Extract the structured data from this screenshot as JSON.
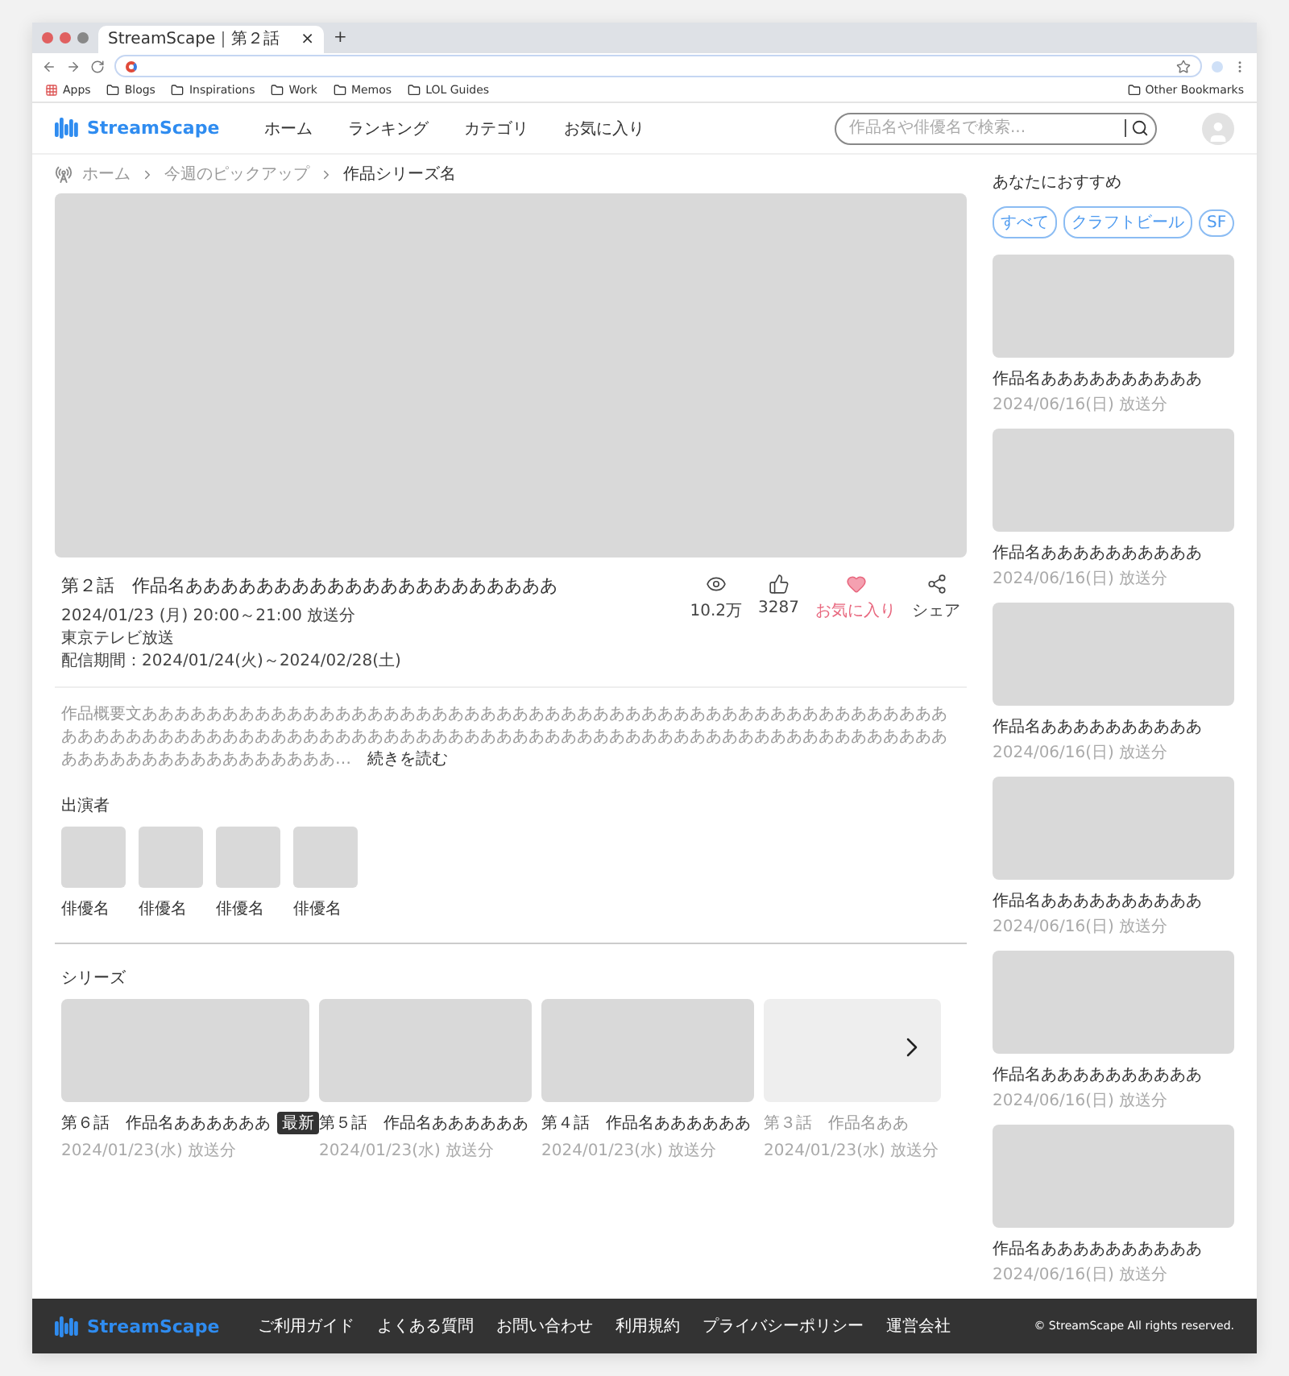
{
  "browser": {
    "tab_title": "StreamScape｜第２話",
    "tab_close": "×",
    "new_tab": "+",
    "bookmarks": [
      "Apps",
      "Blogs",
      "Inspirations",
      "Work",
      "Memos",
      "LOL Guides"
    ],
    "other_bookmarks": "Other Bookmarks"
  },
  "header": {
    "logo": "StreamScape",
    "nav": [
      "ホーム",
      "ランキング",
      "カテゴリ",
      "お気に入り"
    ],
    "search": {
      "placeholder": "作品名や俳優名で検索..."
    }
  },
  "breadcrumb": [
    "ホーム",
    "今週のピックアップ",
    "作品シリーズ名"
  ],
  "episode": {
    "title": "第２話　作品名あああああああああああああああああああああ",
    "meta": [
      "2024/01/23 (月) 20:00～21:00  放送分",
      "東京テレビ放送",
      "配信期間：2024/01/24(火)～2024/02/28(土)"
    ],
    "actions": [
      {
        "kind": "views",
        "label": "10.2万",
        "on": false
      },
      {
        "kind": "likes",
        "label": "3287",
        "on": false
      },
      {
        "kind": "favorite",
        "label": "お気に入り",
        "on": true
      },
      {
        "kind": "share",
        "label": "シェア",
        "on": false
      }
    ],
    "summary": "作品概要文ああああああああああああああああああああああああああああああああああああああああああああああああああああああああああああああああああああああああああああああああああああああああああああああああああああああああああああああああああああああああああ…",
    "read_more": "続きを読む"
  },
  "cast": {
    "heading": "出演者",
    "members": [
      "俳優名",
      "俳優名",
      "俳優名",
      "俳優名"
    ]
  },
  "series": {
    "heading": "シリーズ",
    "episodes": [
      {
        "title": "第６話　作品名ああああああ",
        "badge": "最新",
        "date": "2024/01/23(水) 放送分",
        "faded": false
      },
      {
        "title": "第５話　作品名ああああああ",
        "date": "2024/01/23(水) 放送分",
        "faded": false
      },
      {
        "title": "第４話　作品名ああああああ",
        "date": "2024/01/23(水) 放送分",
        "faded": false
      },
      {
        "title": "第３話　作品名ああ",
        "date": "2024/01/23(水) 放送分",
        "faded": true
      }
    ]
  },
  "sidebar": {
    "heading": "あなたにおすすめ",
    "chips": [
      "すべて",
      "クラフトビール",
      "SF"
    ],
    "items": [
      {
        "title": "作品名ああああああああああ",
        "date": "2024/06/16(日) 放送分"
      },
      {
        "title": "作品名ああああああああああ",
        "date": "2024/06/16(日) 放送分"
      },
      {
        "title": "作品名ああああああああああ",
        "date": "2024/06/16(日) 放送分"
      },
      {
        "title": "作品名ああああああああああ",
        "date": "2024/06/16(日) 放送分"
      },
      {
        "title": "作品名ああああああああああ",
        "date": "2024/06/16(日) 放送分"
      },
      {
        "title": "作品名ああああああああああ",
        "date": "2024/06/16(日) 放送分"
      }
    ]
  },
  "footer": {
    "logo": "StreamScape",
    "links": [
      "ご利用ガイド",
      "よくある質問",
      "お問い合わせ",
      "利用規約",
      "プライバシーポリシー",
      "運営会社"
    ],
    "copyright": "© StreamScape All rights reserved."
  }
}
